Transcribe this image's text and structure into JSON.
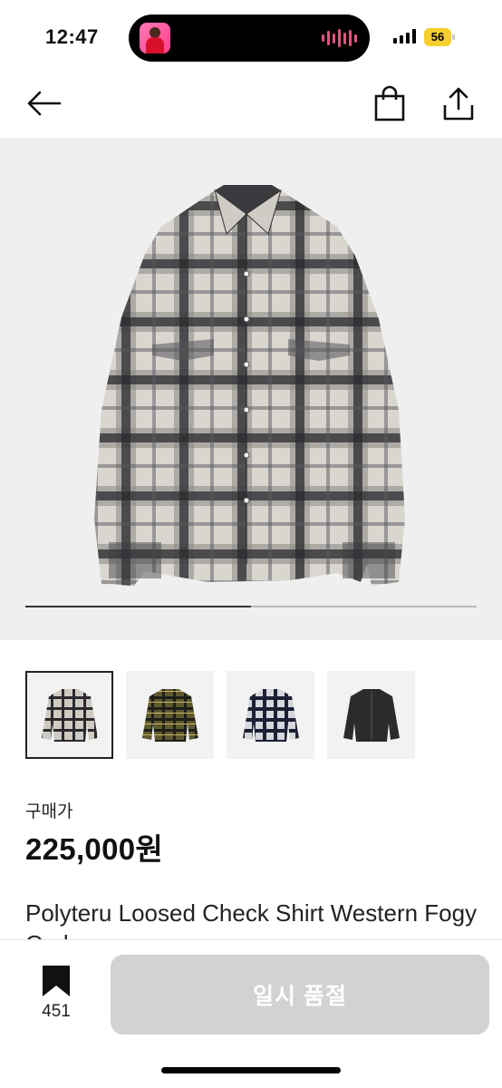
{
  "status_bar": {
    "time": "12:47",
    "battery": "56",
    "island_art_icon": "music-album-art-icon",
    "island_wave_icon": "audio-waveform-icon",
    "signal_icon": "cellular-signal-icon"
  },
  "header": {
    "back_icon": "arrow-left-icon",
    "cart_icon": "shopping-bag-icon",
    "share_icon": "share-upload-icon"
  },
  "gallery": {
    "image": "plaid-check-shirt-photo",
    "progress": 0.5
  },
  "thumbnails": [
    {
      "color": "grey-plaid",
      "selected": true
    },
    {
      "color": "olive-plaid",
      "selected": false
    },
    {
      "color": "navy-plaid",
      "selected": false
    },
    {
      "color": "black",
      "selected": false
    }
  ],
  "product": {
    "price_label": "구매가",
    "price": "225,000원",
    "title": "Polyteru Loosed Check Shirt Western Fogy Ombre"
  },
  "bottom_bar": {
    "bookmark_icon": "bookmark-icon",
    "bookmark_count": "451",
    "cta_label": "일시 품절"
  },
  "colors": {
    "cta_disabled": "#d2d2d2",
    "battery": "#f7cf2e",
    "gallery_bg": "#efefef"
  }
}
